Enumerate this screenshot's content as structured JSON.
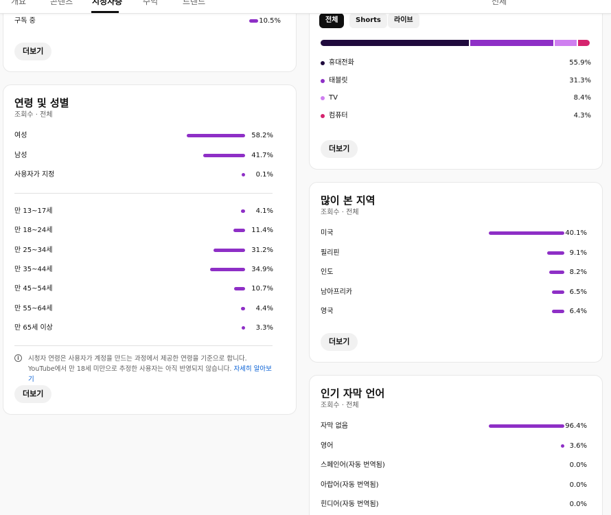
{
  "tabs": [
    {
      "label": "개요"
    },
    {
      "label": "콘텐츠"
    },
    {
      "label": "시청자층"
    },
    {
      "label": "수익"
    },
    {
      "label": "트렌드"
    }
  ],
  "top_right": "전체",
  "subscription": {
    "row": {
      "label": "구독 중",
      "pct": "10.5%"
    },
    "more_label": "더보기"
  },
  "age_gender": {
    "title": "연령 및 성별",
    "subtitle": "조회수 · 전체",
    "gender": [
      {
        "label": "여성",
        "pct": "58.2%",
        "value": 58.2
      },
      {
        "label": "남성",
        "pct": "41.7%",
        "value": 41.7
      },
      {
        "label": "사용자가 지정",
        "pct": "0.1%",
        "value": 0.1
      }
    ],
    "age": [
      {
        "label": "만 13~17세",
        "pct": "4.1%",
        "value": 4.1
      },
      {
        "label": "만 18~24세",
        "pct": "11.4%",
        "value": 11.4
      },
      {
        "label": "만 25~34세",
        "pct": "31.2%",
        "value": 31.2
      },
      {
        "label": "만 35~44세",
        "pct": "34.9%",
        "value": 34.9
      },
      {
        "label": "만 45~54세",
        "pct": "10.7%",
        "value": 10.7
      },
      {
        "label": "만 55~64세",
        "pct": "4.4%",
        "value": 4.4
      },
      {
        "label": "만 65세 이상",
        "pct": "3.3%",
        "value": 3.3
      }
    ],
    "note_text": "시청자 연령은 사용자가 계정을 만드는 과정에서 제공한 연령을 기준으로 합니다. YouTube에서 만 18세 미만으로 추정한 사용자는 아직 반영되지 않습니다.",
    "note_link": "자세히 알아보기",
    "more_label": "더보기"
  },
  "device": {
    "chips": [
      "전체",
      "Shorts",
      "라이브"
    ],
    "items": [
      {
        "label": "휴대전화",
        "pct": "55.9%",
        "value": 55.9,
        "color": "#1f0a3d"
      },
      {
        "label": "태블릿",
        "pct": "31.3%",
        "value": 31.3,
        "color": "#8e2fc6"
      },
      {
        "label": "TV",
        "pct": "8.4%",
        "value": 8.4,
        "color": "#cf7ff0"
      },
      {
        "label": "컴퓨터",
        "pct": "4.3%",
        "value": 4.3,
        "color": "#d5246e"
      }
    ],
    "more_label": "더보기"
  },
  "regions": {
    "title": "많이 본 지역",
    "subtitle": "조회수 · 전체",
    "items": [
      {
        "label": "미국",
        "pct": "40.1%",
        "value": 40.1
      },
      {
        "label": "필리핀",
        "pct": "9.1%",
        "value": 9.1
      },
      {
        "label": "인도",
        "pct": "8.2%",
        "value": 8.2
      },
      {
        "label": "남아프리카",
        "pct": "6.5%",
        "value": 6.5
      },
      {
        "label": "영국",
        "pct": "6.4%",
        "value": 6.4
      }
    ],
    "more_label": "더보기"
  },
  "subtitles": {
    "title": "인기 자막 언어",
    "subtitle": "조회수 · 전체",
    "items": [
      {
        "label": "자막 없음",
        "pct": "96.4%",
        "value": 96.4
      },
      {
        "label": "영어",
        "pct": "3.6%",
        "value": 3.6
      },
      {
        "label": "스페인어(자동 번역됨)",
        "pct": "0.0%",
        "value": 0.0
      },
      {
        "label": "아랍어(자동 번역됨)",
        "pct": "0.0%",
        "value": 0.0
      },
      {
        "label": "힌디어(자동 번역됨)",
        "pct": "0.0%",
        "value": 0.0
      }
    ]
  },
  "colors": {
    "bar": "#8e2fc6",
    "link": "#065fd4"
  }
}
